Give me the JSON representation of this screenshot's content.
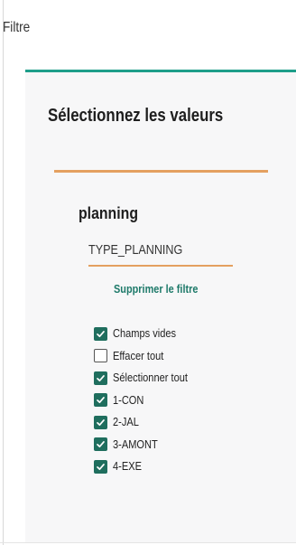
{
  "window": {
    "title": "Filtre"
  },
  "panel": {
    "heading": "Sélectionnez les valeurs"
  },
  "field": {
    "title": "planning",
    "name": "TYPE_PLANNING",
    "remove_label": "Supprimer le filtre"
  },
  "options": [
    {
      "label": "Champs vides",
      "checked": true
    },
    {
      "label": "Effacer tout",
      "checked": false
    },
    {
      "label": "Sélectionner tout",
      "checked": true
    },
    {
      "label": "1-CON",
      "checked": true
    },
    {
      "label": "2-JAL",
      "checked": true
    },
    {
      "label": "3-AMONT",
      "checked": true
    },
    {
      "label": "4-EXE",
      "checked": true
    }
  ],
  "colors": {
    "accent_teal": "#1e9e8a",
    "accent_orange": "#e4a060",
    "checkbox_fill": "#1f6e5e",
    "link": "#1e7a6a"
  }
}
